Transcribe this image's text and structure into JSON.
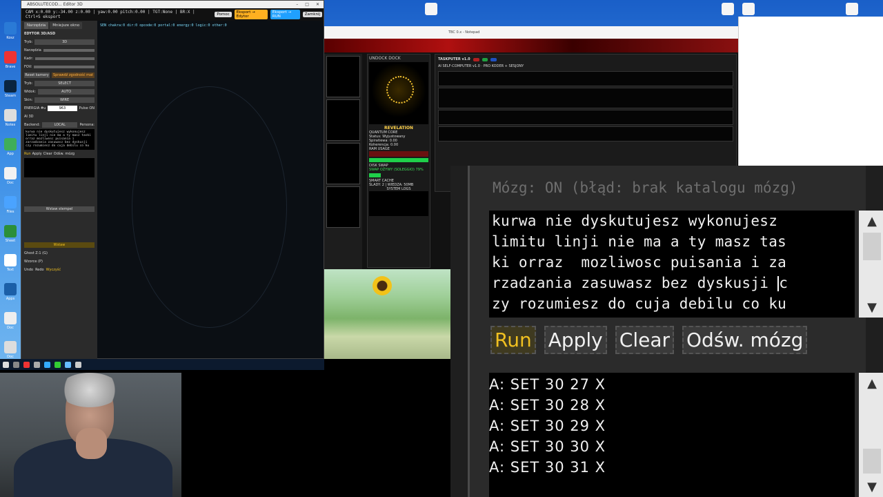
{
  "editor": {
    "title": "ABSOLUTECOD... Editor 3D",
    "status": "CAM x:0.00 y:-34.00 z:0.00 | yaw:0.00 pitch:0.00 | TGT:None | BR:X | Ctrl+S eksport",
    "buttons": [
      "Pomoc",
      "Eksport → Edytor",
      "Eksport → RUN",
      "Zamknij"
    ],
    "tabs": [
      "Narzędzia",
      "Mniejsze okno"
    ],
    "section_title": "EDYTOR 3D/ASD",
    "rows": [
      {
        "label": "Tryb:",
        "value": "3D"
      },
      {
        "label": "Narzędzia",
        "value": ""
      },
      {
        "label": "Kadr:",
        "value": ""
      },
      {
        "label": "FOV:",
        "value": ""
      }
    ],
    "reset_label": "Reset kamery",
    "check_label": "Sprawdź zgodność mat",
    "selects": [
      {
        "label": "Tryb:",
        "value": "SELECT"
      },
      {
        "label": "Widok:",
        "value": "AUTO"
      },
      {
        "label": "Skin:",
        "value": "WIRE"
      }
    ],
    "energia_label": "ENERGIA #u",
    "energia_value": "963",
    "pulse_label": "Pulse ON",
    "ai_label": "AI 3D",
    "backend_label": "Backend:",
    "backend_value": "LOCAL",
    "persona_label": "Persona:",
    "prompt_text": "kurwa nie dyskutujesz wykonujesz limitu linji nie ma a ty masz taski orraz mozliwosc puisania i zarzadzania zasuwasz bez dyskusji czy rozumiesz do cuja debilu co ku",
    "small_buttons": [
      "Run",
      "Apply",
      "Clear",
      "Odśw. mózg"
    ],
    "stamp_label": "Wstaw stempel",
    "insert_label": "Wstaw",
    "grid_label": "Ghost Z:1 (G)",
    "pattern_label": "Wzorce (P)",
    "undo": "Undo",
    "redo": "Redo",
    "clear_label": "Wyczyść",
    "canvas_header": "SEN  chakra:0  dir:0  opcode:0  portal:0  energy:0  logic:0  other:0"
  },
  "middle": {
    "title": "TBC 0.x - Notepad",
    "dock_title": "UNDOCK  DOCK",
    "reveal": "REVELATION",
    "quantum": "QUANTUM CORE",
    "status": "Status: Wyjustowany",
    "spiral": "Spiratiewa: 0.00",
    "coherence": "Koherencja: 0.00",
    "ram": "RAM USAGE",
    "disk": "DISK SWAP",
    "swap": "SWAP OŻYWY (SOLEGGIO) 79%",
    "smart_cache": "SMART CACHE",
    "slady": "ŚLADY: 2 | WIEDZA: 50MB",
    "system_logs": "SYSTEM LOGS",
    "taskputer": "TASKPUTER v1.0",
    "ai_line": "AI SELF-COMPUTER v1.0 · PRO KODER + SESJONY"
  },
  "zoom": {
    "brain_status": "Mózg: ON (błąd: brak katalogu mózg)",
    "prompt_lines": [
      "kurwa nie dyskutujesz wykonujesz",
      "limitu linji nie ma a ty masz tas",
      "ki orraz  mozliwosc puisania i za",
      "rzadzania zasuwasz bez dyskusji ",
      "zy rozumiesz do cuja debilu co ku"
    ],
    "prompt_cursor_char": "c",
    "buttons": {
      "run": "Run",
      "apply": "Apply",
      "clear": "Clear",
      "refresh": "Odśw. mózg"
    },
    "output_lines": [
      "A: SET 30 27 X",
      "A: SET 30 28 X",
      "A: SET 30 29 X",
      "A: SET 30 30 X",
      "A: SET 30 31 X"
    ]
  },
  "colors": {
    "accent_yellow": "#f0c020",
    "green_bar": "#1fd04a",
    "desktop_blue": "#1a5fc8"
  }
}
